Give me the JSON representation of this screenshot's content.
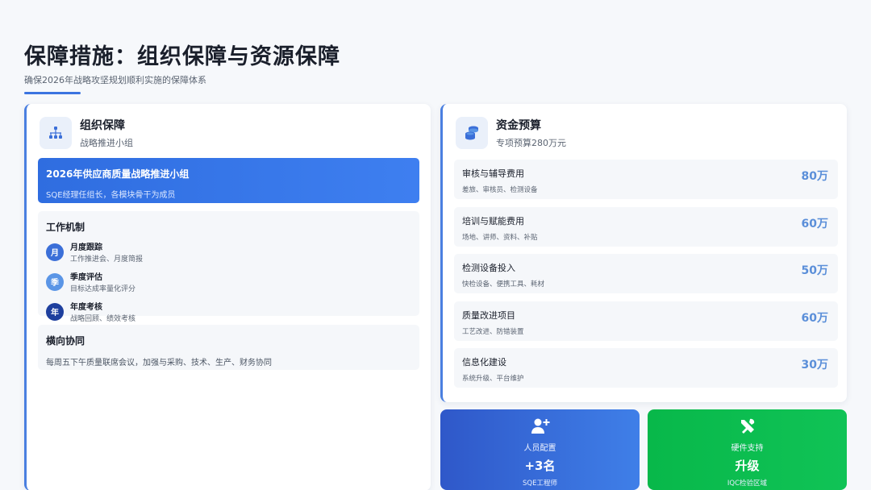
{
  "header": {
    "title": "保障措施：组织保障与资源保障",
    "subtitle": "确保2026年战略攻坚规划顺利实施的保障体系"
  },
  "organization": {
    "title": "组织保障",
    "subtitle": "战略推进小组",
    "icon": "org-chart-icon",
    "banner": {
      "title": "2026年供应商质量战略推进小组",
      "subtitle": "SQE经理任组长，各模块骨干为成员"
    },
    "mechanism": {
      "title": "工作机制",
      "items": [
        {
          "badge": "月",
          "name": "月度跟踪",
          "desc": "工作推进会、月度简报",
          "color": "#3b6fd8"
        },
        {
          "badge": "季",
          "name": "季度评估",
          "desc": "目标达成率量化评分",
          "color": "#5a95e6"
        },
        {
          "badge": "年",
          "name": "年度考核",
          "desc": "战略回顾、绩效考核",
          "color": "#1e3f9e"
        }
      ]
    },
    "horizontal": {
      "title": "横向协同",
      "desc": "每周五下午质量联席会议，加强与采购、技术、生产、财务协同"
    }
  },
  "budget": {
    "title": "资金预算",
    "subtitle": "专项预算280万元",
    "icon": "coins-stack-icon",
    "items": [
      {
        "name": "审核与辅导费用",
        "desc": "差旅、审核员、检测设备",
        "amount": "80万"
      },
      {
        "name": "培训与赋能费用",
        "desc": "场地、讲师、资料、补贴",
        "amount": "60万"
      },
      {
        "name": "检测设备投入",
        "desc": "快检设备、便携工具、耗材",
        "amount": "50万"
      },
      {
        "name": "质量改进项目",
        "desc": "工艺改进、防错装置",
        "amount": "60万"
      },
      {
        "name": "信息化建设",
        "desc": "系统升级、平台维护",
        "amount": "30万"
      }
    ]
  },
  "tiles": {
    "staff": {
      "label": "人员配置",
      "value": "+3名",
      "sub": "SQE工程师",
      "icon": "add-user-icon"
    },
    "hardware": {
      "label": "硬件支持",
      "value": "升级",
      "sub": "IQC检验区域",
      "icon": "tools-icon"
    }
  },
  "colors": {
    "accent": "#3b74e0",
    "green": "#0abf50",
    "amount": "#5b8fd9"
  }
}
